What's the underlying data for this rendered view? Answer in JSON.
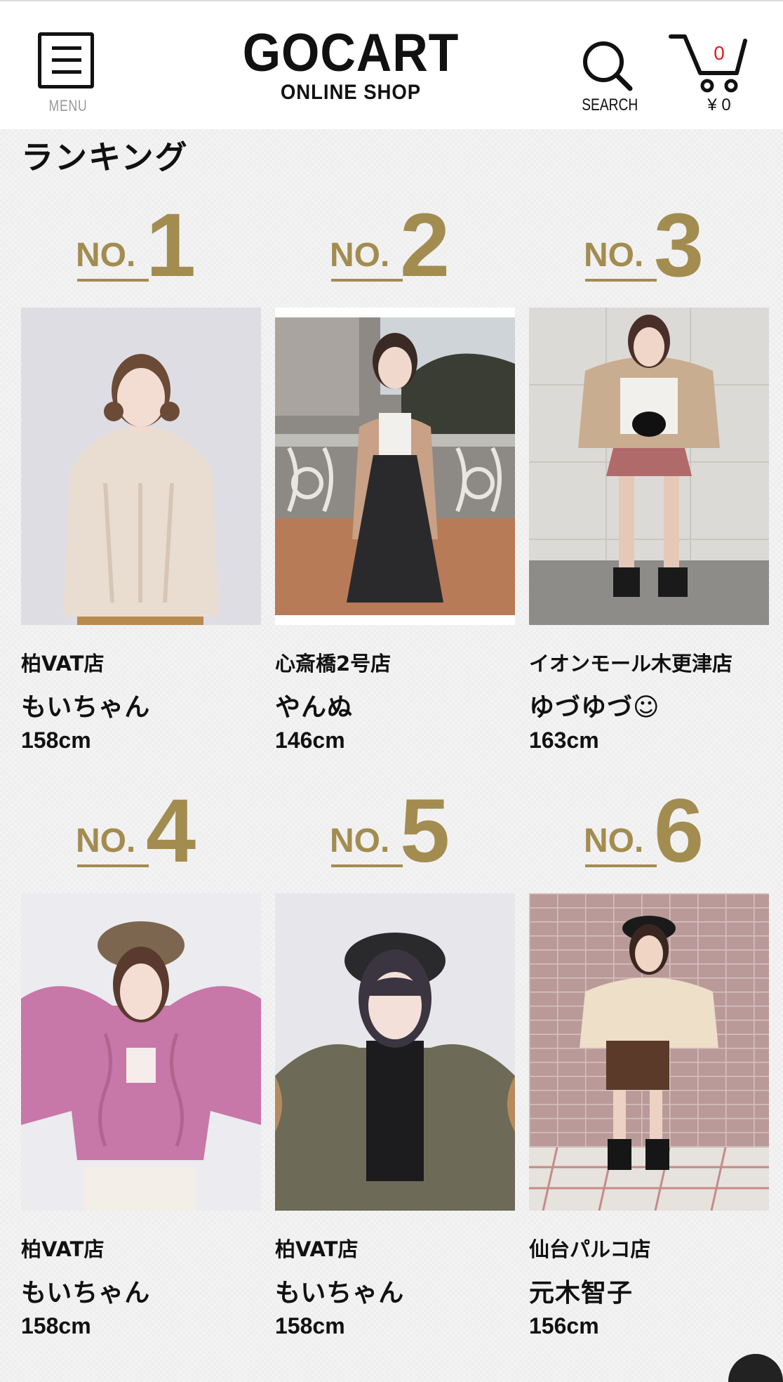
{
  "header": {
    "menu_label": "MENU",
    "logo_main": "GOCART",
    "logo_sub": "ONLINE SHOP",
    "search_label": "SEARCH",
    "cart_count": "0",
    "cart_total": "¥ 0",
    "accent_color": "#e02020"
  },
  "section": {
    "title": "ランキング",
    "gold_color": "#a38c4f"
  },
  "rankings": [
    {
      "no_label": "NO.",
      "rank": "1",
      "store": "柏VAT店",
      "name": "もいちゃん",
      "height": "158cm"
    },
    {
      "no_label": "NO.",
      "rank": "2",
      "store": "心斎橋2号店",
      "name": "やんぬ",
      "height": "146cm"
    },
    {
      "no_label": "NO.",
      "rank": "3",
      "store": "イオンモール木更津店",
      "name": "ゆづゆづ☺",
      "height": "163cm"
    },
    {
      "no_label": "NO.",
      "rank": "4",
      "store": "柏VAT店",
      "name": "もいちゃん",
      "height": "158cm"
    },
    {
      "no_label": "NO.",
      "rank": "5",
      "store": "柏VAT店",
      "name": "もいちゃん",
      "height": "158cm"
    },
    {
      "no_label": "NO.",
      "rank": "6",
      "store": "仙台パルコ店",
      "name": "元木智子",
      "height": "156cm"
    }
  ]
}
